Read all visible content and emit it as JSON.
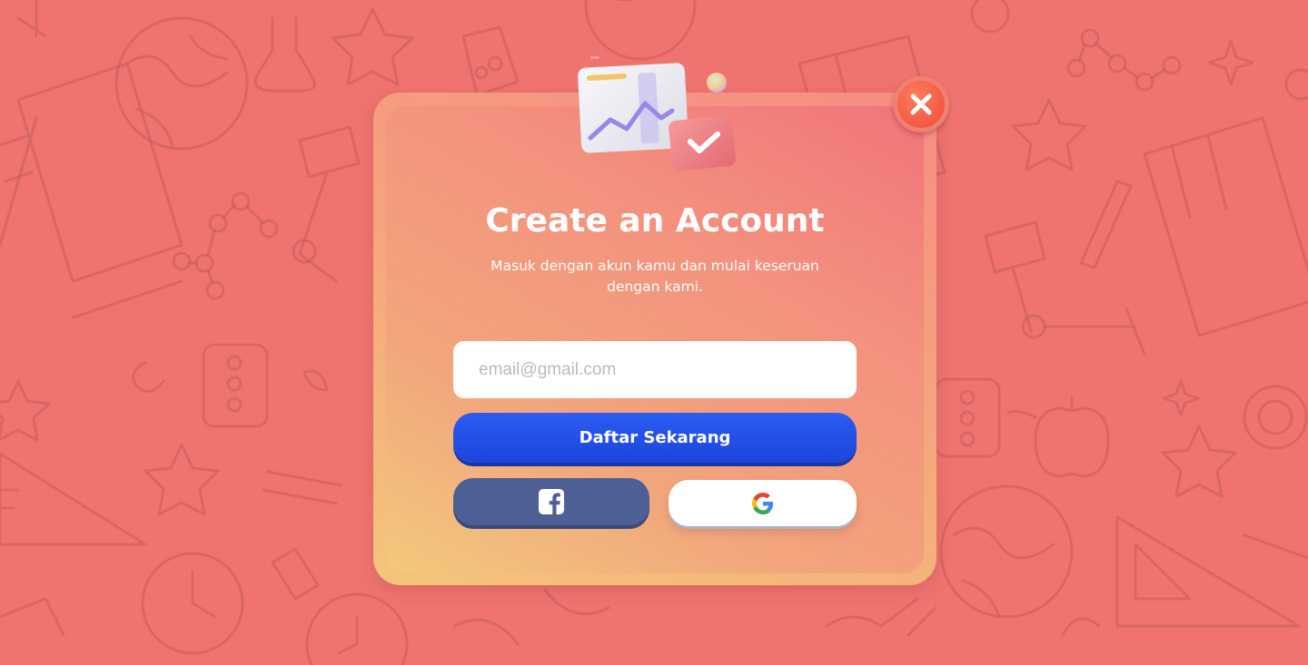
{
  "modal": {
    "title": "Create an Account",
    "subtitle": "Masuk dengan akun kamu dan mulai keseruan dengan kami.",
    "email_placeholder": "email@gmail.com",
    "register_label": "Daftar Sekarang",
    "social_buttons": [
      {
        "provider": "facebook",
        "icon": "facebook-icon",
        "color": "#4e5f96"
      },
      {
        "provider": "google",
        "icon": "google-icon",
        "color": "#ffffff"
      }
    ],
    "close_icon": "close-icon"
  },
  "colors": {
    "background": "#ef7470",
    "primary_button": "#2a5cf3",
    "facebook": "#4e5f96",
    "close": "#f25a43"
  }
}
